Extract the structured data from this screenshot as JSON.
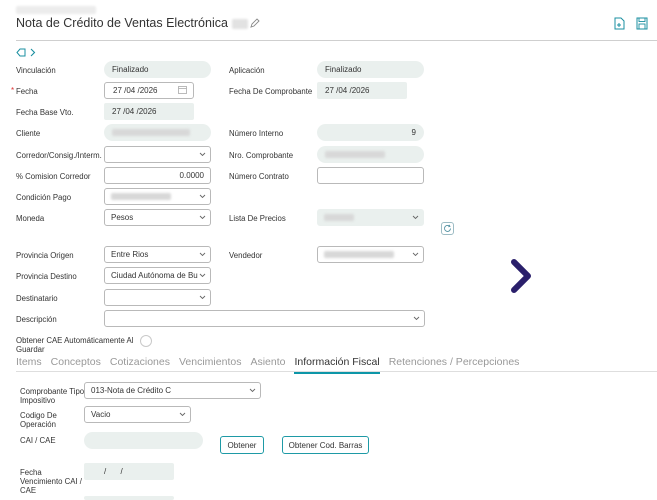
{
  "header": {
    "title": "Nota de Crédito de Ventas Electrónica"
  },
  "form": {
    "vinculacion": {
      "label": "Vinculación",
      "value": "Finalizado"
    },
    "aplicacion": {
      "label": "Aplicación",
      "value": "Finalizado"
    },
    "fecha": {
      "label": "Fecha",
      "required_mark": "*",
      "value": "27 /04 /2026"
    },
    "fecha_comprobante": {
      "label": "Fecha De Comprobante",
      "value": "27 /04 /2026"
    },
    "fecha_base_vto": {
      "label": "Fecha Base Vto.",
      "value": "27 /04 /2026"
    },
    "cliente": {
      "label": "Cliente"
    },
    "numero_interno": {
      "label": "Número Interno",
      "value": "9"
    },
    "corredor": {
      "label": "Corredor/Consig./Interm."
    },
    "nro_comprobante": {
      "label": "Nro. Comprobante"
    },
    "comision_corredor": {
      "label": "% Comision Corredor",
      "value": "0.0000"
    },
    "numero_contrato": {
      "label": "Número Contrato"
    },
    "condicion_pago": {
      "label": "Condición Pago"
    },
    "moneda": {
      "label": "Moneda",
      "value": "Pesos"
    },
    "lista_precios": {
      "label": "Lista De Precios"
    },
    "provincia_origen": {
      "label": "Provincia Origen",
      "value": "Entre Rios"
    },
    "vendedor": {
      "label": "Vendedor"
    },
    "provincia_destino": {
      "label": "Provincia Destino",
      "value": "Ciudad Autónoma de Bu"
    },
    "destinatario": {
      "label": "Destinatario"
    },
    "descripcion": {
      "label": "Descripción"
    },
    "obtener_cae_auto": {
      "label_line1": "Obtener CAE Automáticamente Al",
      "label_line2": "Guardar"
    }
  },
  "tabs": [
    {
      "label": "Items"
    },
    {
      "label": "Conceptos"
    },
    {
      "label": "Cotizaciones"
    },
    {
      "label": "Vencimientos"
    },
    {
      "label": "Asiento"
    },
    {
      "label": "Información Fiscal",
      "active": true
    },
    {
      "label": "Retenciones / Percepciones"
    }
  ],
  "fiscal": {
    "comprobante_tipo": {
      "label_line1": "Comprobante Tipo",
      "label_line2": "Impositivo",
      "value": "013-Nota de Crédito C"
    },
    "codigo_operacion": {
      "label_line1": "Codigo De",
      "label_line2": "Operación",
      "value": "Vacio"
    },
    "cai_cae": {
      "label": "CAI / CAE"
    },
    "obtener_button": "Obtener",
    "obtener_cod_barras_button": "Obtener Cod. Barras",
    "fecha_vencimiento": {
      "label_line1": "Fecha",
      "label_line2": "Vencimiento CAI /",
      "label_line3": "CAE",
      "value": "/ /"
    }
  },
  "colors": {
    "accent": "#0d96a8",
    "readonly_bg": "#eaf0ee",
    "nav_arrow": "#2a1f6b"
  }
}
